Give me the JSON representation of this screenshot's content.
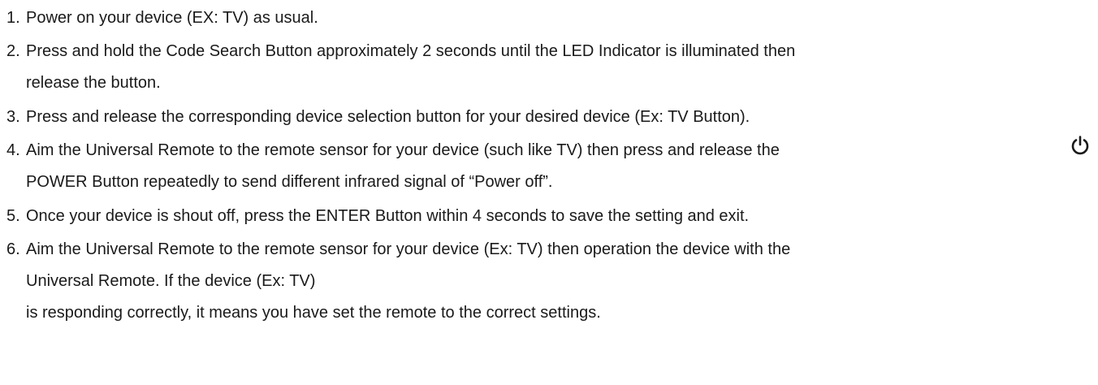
{
  "steps": [
    {
      "number": "1.",
      "lines": [
        "Power on your device (EX: TV) as usual."
      ]
    },
    {
      "number": "2.",
      "lines": [
        "Press and hold the Code Search Button approximately 2 seconds until the LED Indicator is illuminated then",
        "release the button."
      ]
    },
    {
      "number": "3.",
      "lines": [
        "Press and release the corresponding device selection button for your desired device (Ex: TV Button)."
      ]
    },
    {
      "number": "4.",
      "lines": [
        "Aim the Universal Remote to the remote sensor for your device (such like TV) then press and release the",
        " POWER Button repeatedly to send different infrared signal of “Power off”."
      ]
    },
    {
      "number": "5.",
      "lines": [
        "Once your device is shout off, press the ENTER Button within 4 seconds to save the setting and exit."
      ]
    },
    {
      "number": "6.",
      "lines": [
        "Aim the Universal Remote  to the remote sensor for your device (Ex: TV) then operation the device with the",
        "Universal Remote. If the device (Ex: TV)",
        "is responding correctly, it means you have set the remote to the correct settings."
      ]
    }
  ],
  "icons": {
    "power": "power-icon"
  }
}
